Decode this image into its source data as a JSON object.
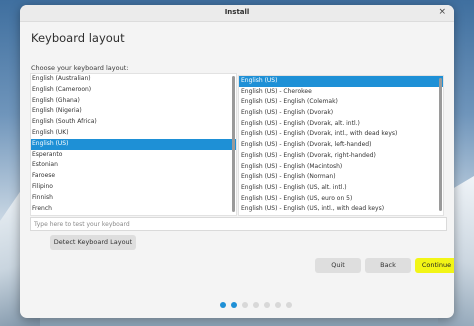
{
  "window": {
    "title": "Install",
    "close_glyph": "×"
  },
  "page": {
    "heading": "Keyboard layout",
    "subheading": "Choose your keyboard layout:"
  },
  "layouts": {
    "items": [
      "English (Australian)",
      "English (Cameroon)",
      "English (Ghana)",
      "English (Nigeria)",
      "English (South Africa)",
      "English (UK)",
      "English (US)",
      "Esperanto",
      "Estonian",
      "Faroese",
      "Filipino",
      "Finnish",
      "French"
    ],
    "selected": "English (US)"
  },
  "variants": {
    "items": [
      "English (US)",
      "English (US) - Cherokee",
      "English (US) - English (Colemak)",
      "English (US) - English (Dvorak)",
      "English (US) - English (Dvorak, alt. intl.)",
      "English (US) - English (Dvorak, intl., with dead keys)",
      "English (US) - English (Dvorak, left-handed)",
      "English (US) - English (Dvorak, right-handed)",
      "English (US) - English (Macintosh)",
      "English (US) - English (Norman)",
      "English (US) - English (US, alt. intl.)",
      "English (US) - English (US, euro on 5)",
      "English (US) - English (US, intl., with dead keys)"
    ],
    "selected": "English (US)"
  },
  "test_field": {
    "placeholder": "Type here to test your keyboard",
    "value": ""
  },
  "buttons": {
    "detect": "Detect Keyboard Layout",
    "quit": "Quit",
    "back": "Back",
    "continue": "Continue"
  },
  "progress": {
    "total_steps": 7,
    "current_step": 2
  },
  "colors": {
    "selection": "#1e90d6",
    "continue": "#f2f516",
    "dot_active": "#1e90d6",
    "dot_inactive": "#d8d8d8"
  }
}
